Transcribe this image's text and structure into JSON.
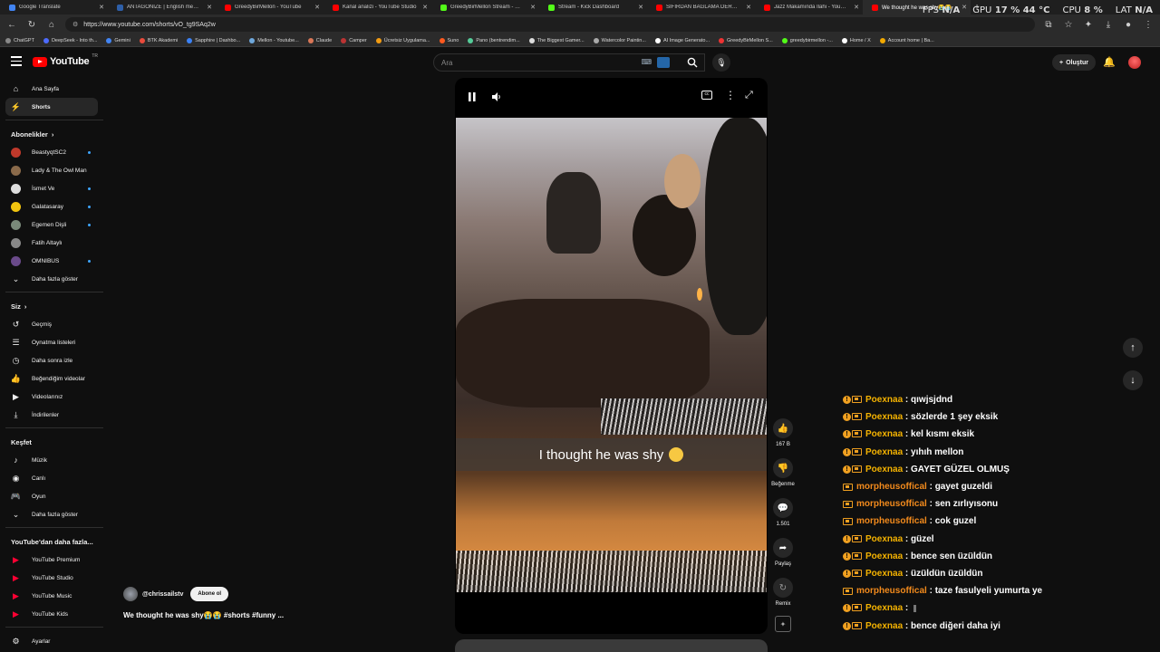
{
  "browser": {
    "tabs": [
      {
        "label": "Google Translate",
        "color": "#4285f4",
        "active": false
      },
      {
        "label": "ANTAGONIZE | English meaning -",
        "color": "#2e5fa8",
        "active": false
      },
      {
        "label": "GreedyBirMellon - YouTube",
        "color": "#ff0000",
        "active": false
      },
      {
        "label": "Kanal analizi - YouTube Studio",
        "color": "#ff0000",
        "active": false
      },
      {
        "label": "GreedyBirMellon Stream - Watch (",
        "color": "#53fc18",
        "active": false
      },
      {
        "label": "Stream - Kick Dashboard",
        "color": "#53fc18",
        "active": false
      },
      {
        "label": "SIFIRDAN BAĞLAMA DERSİ 7 | BU",
        "color": "#ff0000",
        "active": false
      },
      {
        "label": "Jazz Makamında İlahi - YouTube",
        "color": "#ff0000",
        "active": false
      },
      {
        "label": "We thought he was shy😭😭",
        "color": "#ff0000",
        "active": true
      }
    ],
    "url": "https://www.youtube.com/shorts/vO_tg9SAq2w",
    "hud": {
      "fps_label": "FPS",
      "fps_value": "N/A",
      "gpu_label": "GPU",
      "gpu_value": "17 % 44 °C",
      "cpu_label": "CPU",
      "cpu_value": "8 %",
      "lat_label": "LAT",
      "lat_value": "N/A"
    },
    "bookmarks": [
      {
        "label": "ChatGPT",
        "color": "#888"
      },
      {
        "label": "DeepSeek - Into th...",
        "color": "#4d6bfe"
      },
      {
        "label": "Gemini",
        "color": "#4285f4"
      },
      {
        "label": "BTK Akademi",
        "color": "#e94b3c"
      },
      {
        "label": "Sapphire | Dashbo...",
        "color": "#3b82f6"
      },
      {
        "label": "Mellon - Youtube...",
        "color": "#6fa8dc"
      },
      {
        "label": "Claude",
        "color": "#d97757"
      },
      {
        "label": "Camper",
        "color": "#b33"
      },
      {
        "label": "Ücretsiz Uygulama...",
        "color": "#f39c12"
      },
      {
        "label": "Suno",
        "color": "#ff5a1f"
      },
      {
        "label": "Pano (bentrendim...",
        "color": "#5c9"
      },
      {
        "label": "The Biggest Gamer...",
        "color": "#ddd"
      },
      {
        "label": "Watercolor Paintin...",
        "color": "#aaa"
      },
      {
        "label": "AI Image Generato...",
        "color": "#fff"
      },
      {
        "label": "GreedyBirMellon S...",
        "color": "#e33"
      },
      {
        "label": "greedybirmellon -...",
        "color": "#53fc18"
      },
      {
        "label": "Home / X",
        "color": "#fff"
      },
      {
        "label": "Account home | Ba...",
        "color": "#f2a900"
      }
    ]
  },
  "header": {
    "logo_text": "YouTube",
    "logo_region": "TR",
    "search_placeholder": "Ara",
    "create_label": "Oluştur"
  },
  "sidebar": {
    "main": [
      {
        "label": "Ana Sayfa",
        "icon": "home-icon",
        "glyph": "⌂"
      },
      {
        "label": "Shorts",
        "icon": "shorts-icon",
        "glyph": "⚡"
      }
    ],
    "subs_header": "Abonelikler",
    "subs": [
      {
        "label": "BeastyqtSC2",
        "color": "#c0392b",
        "dot": true
      },
      {
        "label": "Lady & The Owl Man",
        "color": "#8a6a4a",
        "dot": false
      },
      {
        "label": "İsmet Ve",
        "color": "#ddd",
        "dot": true
      },
      {
        "label": "Galatasaray",
        "color": "#f1c40f",
        "dot": true
      },
      {
        "label": "Egemen Dişli",
        "color": "#7a8a7a",
        "dot": true
      },
      {
        "label": "Fatih Altaylı",
        "color": "#888",
        "dot": false
      },
      {
        "label": "OMNIBUS",
        "color": "#6a4a8a",
        "dot": true
      }
    ],
    "subs_more": "Daha fazla göster",
    "you_header": "Siz",
    "you": [
      {
        "label": "Geçmiş",
        "glyph": "↺",
        "icon": "history-icon"
      },
      {
        "label": "Oynatma listeleri",
        "glyph": "☰",
        "icon": "playlists-icon"
      },
      {
        "label": "Daha sonra izle",
        "glyph": "◷",
        "icon": "watch-later-icon"
      },
      {
        "label": "Beğendiğim videolar",
        "glyph": "👍",
        "icon": "liked-icon"
      },
      {
        "label": "Videolarınız",
        "glyph": "▶",
        "icon": "your-videos-icon"
      },
      {
        "label": "İndirilenler",
        "glyph": "⤓",
        "icon": "downloads-icon"
      }
    ],
    "explore_header": "Keşfet",
    "explore": [
      {
        "label": "Müzik",
        "glyph": "♪",
        "icon": "music-icon"
      },
      {
        "label": "Canlı",
        "glyph": "◉",
        "icon": "live-icon"
      },
      {
        "label": "Oyun",
        "glyph": "🎮",
        "icon": "gaming-icon"
      },
      {
        "label": "Daha fazla göster",
        "glyph": "⌄",
        "icon": "chevron-down-icon"
      }
    ],
    "more_header": "YouTube'dan daha fazla...",
    "more": [
      {
        "label": "YouTube Premium"
      },
      {
        "label": "YouTube Studio"
      },
      {
        "label": "YouTube Music"
      },
      {
        "label": "YouTube Kids"
      }
    ],
    "settings": "Ayarlar"
  },
  "video": {
    "caption": "I thought he was shy",
    "channel": "@chrissailstv",
    "subscribe": "Abone ol",
    "title": "We thought he was shy😭😭 #shorts #funny ..."
  },
  "actions": {
    "likes": "167 B",
    "dislike": "Beğenme",
    "comments": "1.501",
    "share": "Paylaş",
    "remix": "Remix"
  },
  "chat": [
    {
      "user": "Poexnaa",
      "type": "poex",
      "info": true,
      "msg": "qıwjsjdnd"
    },
    {
      "user": "Poexnaa",
      "type": "poex",
      "info": true,
      "msg": "sözlerde 1 şey eksik"
    },
    {
      "user": "Poexnaa",
      "type": "poex",
      "info": true,
      "msg": "kel kısmı eksik"
    },
    {
      "user": "Poexnaa",
      "type": "poex",
      "info": true,
      "msg": "yıhıh mellon"
    },
    {
      "user": "Poexnaa",
      "type": "poex",
      "info": true,
      "msg": "GAYET GÜZEL OLMUŞ"
    },
    {
      "user": "morpheusoffical",
      "type": "morph",
      "info": false,
      "msg": "gayet guzeldi"
    },
    {
      "user": "morpheusoffical",
      "type": "morph",
      "info": false,
      "msg": "sen zırlıyısonu"
    },
    {
      "user": "morpheusoffical",
      "type": "morph",
      "info": false,
      "msg": "cok guzel"
    },
    {
      "user": "Poexnaa",
      "type": "poex",
      "info": true,
      "msg": "güzel"
    },
    {
      "user": "Poexnaa",
      "type": "poex",
      "info": true,
      "msg": "bence sen üzüldün"
    },
    {
      "user": "Poexnaa",
      "type": "poex",
      "info": true,
      "msg": "üzüldün üzüldün"
    },
    {
      "user": "morpheusoffical",
      "type": "morph",
      "info": false,
      "msg": "taze fasulyeli yumurta ye"
    },
    {
      "user": "Poexnaa",
      "type": "poex",
      "info": true,
      "msg": ""
    },
    {
      "user": "Poexnaa",
      "type": "poex",
      "info": true,
      "msg": "bence diğeri daha iyi"
    }
  ],
  "chat_separator": " : "
}
